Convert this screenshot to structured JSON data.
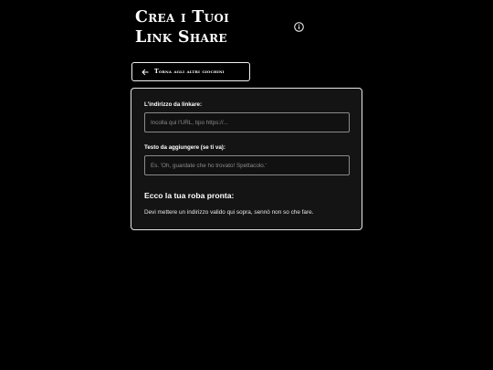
{
  "header": {
    "title_line1": "Crea i Tuoi",
    "title_line2": "Link Share",
    "info_icon": "info-circle-icon"
  },
  "back_button": {
    "icon": "arrow-left-icon",
    "label": "Torna agli altri giochini"
  },
  "form": {
    "url_label": "L'indirizzo da linkare:",
    "url_value": "",
    "url_placeholder": "Incolla qui l'URL, tipo https://...",
    "text_label": "Testo da aggiungere (se ti va):",
    "text_value": "",
    "text_placeholder": "Es. 'Oh, guardate che ho trovato! Spettacolo.'"
  },
  "result": {
    "heading": "Ecco la tua roba pronta:",
    "message": "Devi mettere un indirizzo valido qui sopra, sennò non so che fare."
  },
  "colors": {
    "background": "#000000",
    "card": "#141414",
    "text": "#ffffff",
    "border": "#e6e6e6"
  }
}
